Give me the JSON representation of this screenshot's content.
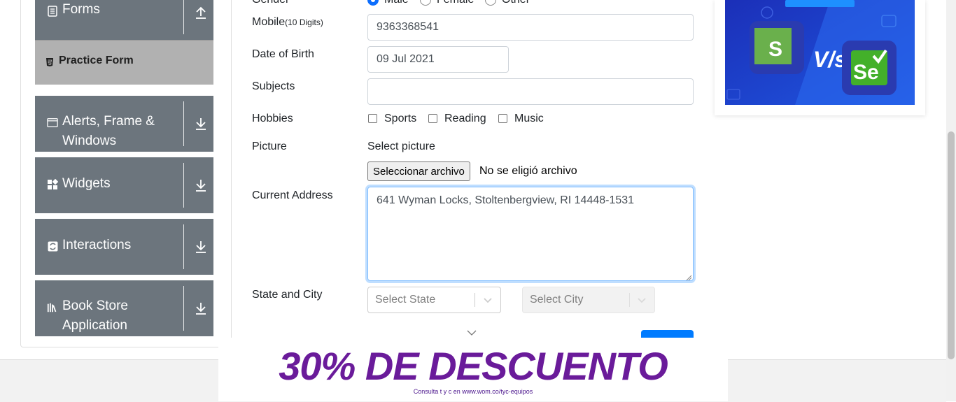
{
  "sidebar": {
    "forms_label": "Forms",
    "practice_form_label": "Practice Form",
    "alerts_label_line1": "Alerts, Frame &",
    "alerts_label_line2": "Windows",
    "widgets_label": "Widgets",
    "interactions_label": "Interactions",
    "bookstore_label_line1": "Book Store",
    "bookstore_label_line2": "Application"
  },
  "form": {
    "gender_label": "Gender",
    "gender_options": [
      "Male",
      "Female",
      "Other"
    ],
    "mobile_label": "Mobile",
    "mobile_hint": "(10 Digits)",
    "mobile_value": "9363368541",
    "dob_label": "Date of Birth",
    "dob_value": "09 Jul 2021",
    "subjects_label": "Subjects",
    "hobbies_label": "Hobbies",
    "hobbies": [
      "Sports",
      "Reading",
      "Music"
    ],
    "picture_label": "Picture",
    "select_picture": "Select picture",
    "file_button": "Seleccionar archivo",
    "file_status": "No se eligió archivo",
    "address_label": "Current Address",
    "address_value": "641 Wyman Locks, Stoltenbergview, RI 14448-1531",
    "state_city_label": "State and City",
    "state_placeholder": "Select State",
    "city_placeholder": "Select City"
  },
  "bottom_ad": {
    "headline": "30% DE DESCUENTO",
    "fineprint": "Consulta t y c en www.wom.co/tyc-equipos"
  },
  "colors": {
    "sidebar_group": "#6c757d",
    "sidebar_active": "#b1b1b1",
    "focus": "#80bdff",
    "ad_purple": "#6a1b9a",
    "ad_blue": "#1a3fd6"
  }
}
